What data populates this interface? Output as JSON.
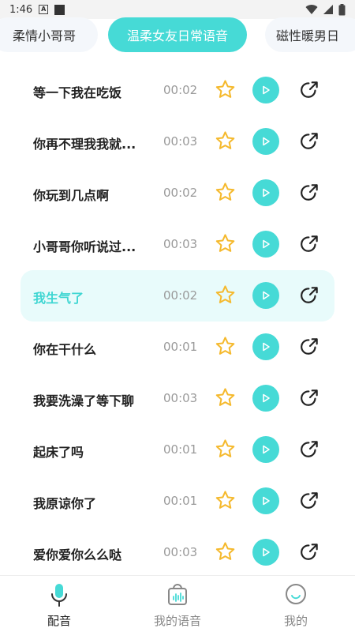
{
  "status_bar": {
    "time": "1:46"
  },
  "tabs": [
    {
      "label": "柔情小哥哥"
    },
    {
      "label": "温柔女友日常语音"
    },
    {
      "label": "磁性暖男日"
    }
  ],
  "items": [
    {
      "title": "等一下我在吃饭",
      "duration": "00:02"
    },
    {
      "title": "你再不理我我就...",
      "duration": "00:03"
    },
    {
      "title": "你玩到几点啊",
      "duration": "00:02"
    },
    {
      "title": "小哥哥你听说过...",
      "duration": "00:03"
    },
    {
      "title": "我生气了",
      "duration": "00:02"
    },
    {
      "title": "你在干什么",
      "duration": "00:01"
    },
    {
      "title": "我要洗澡了等下聊",
      "duration": "00:03"
    },
    {
      "title": "起床了吗",
      "duration": "00:01"
    },
    {
      "title": "我原谅你了",
      "duration": "00:01"
    },
    {
      "title": "爱你爱你么么哒",
      "duration": "00:03"
    }
  ],
  "bottom_nav": [
    {
      "label": "配音",
      "icon": "microphone-icon"
    },
    {
      "label": "我的语音",
      "icon": "voice-bag-icon"
    },
    {
      "label": "我的",
      "icon": "smiley-icon"
    }
  ],
  "colors": {
    "accent": "#46dad6",
    "active_row_bg": "#e8fbfb",
    "star": "#f5b92d"
  }
}
